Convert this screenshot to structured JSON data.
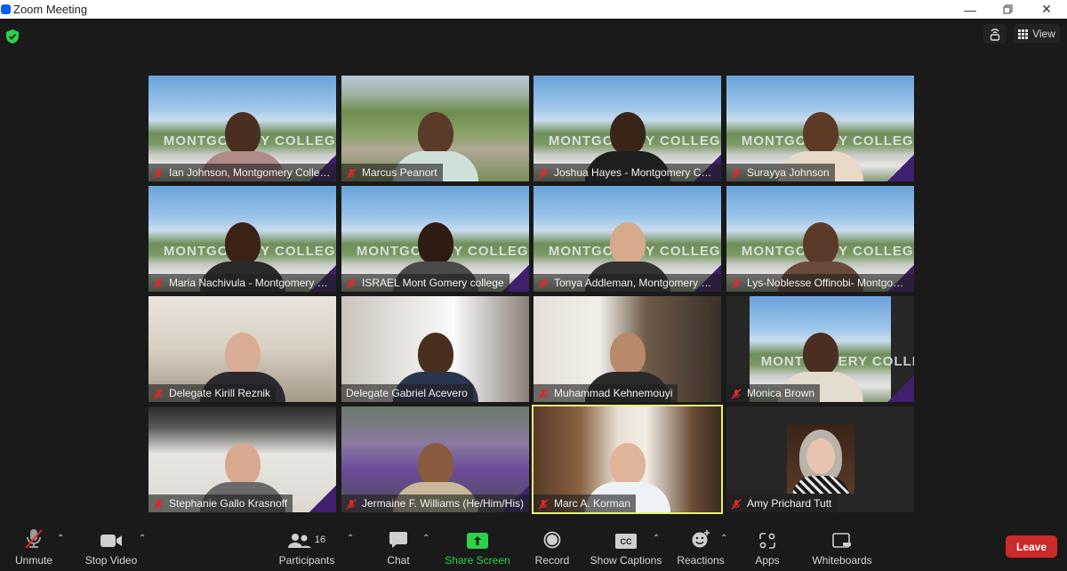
{
  "window": {
    "title": "Zoom Meeting",
    "minimize_icon": "minimize-icon",
    "restore_icon": "restore-icon",
    "close_icon": "close-icon"
  },
  "topbar": {
    "security_icon": "shield-check-icon",
    "immersive_icon": "immersive-view-icon",
    "view_label": "View"
  },
  "participants": [
    {
      "name": "Ian Johnson, Montgomery College",
      "muted": true,
      "bg": "campus",
      "sign": "MONTGOMERY COLLEGE",
      "skin": "#4a2e22",
      "shirt": "#b08a86"
    },
    {
      "name": "Marcus Peanort",
      "muted": true,
      "bg": "aerial",
      "sign": "",
      "skin": "#5a3a28",
      "shirt": "#cfe0d8"
    },
    {
      "name": "Joshua Hayes -  Montgomery Coll...",
      "muted": true,
      "bg": "campus",
      "sign": "MONTGOMERY COLLEGE",
      "skin": "#3a2418",
      "shirt": "#1e1e1e"
    },
    {
      "name": "Surayya Johnson",
      "muted": true,
      "bg": "campus",
      "sign": "MONTGOMERY COLLEGE",
      "skin": "#5c3a26",
      "shirt": "#e8d9c8"
    },
    {
      "name": "Maria Nachivula - Montgomery C...",
      "muted": true,
      "bg": "campus",
      "sign": "MONTGOMERY COLLEGE",
      "skin": "#3a2216",
      "shirt": "#2a2a2a"
    },
    {
      "name": "ISRAEL Mont Gomery college",
      "muted": true,
      "bg": "campus",
      "sign": "MONTGOMERY COLLEGE",
      "skin": "#2e1c12",
      "shirt": "#4a4a4a"
    },
    {
      "name": "Tonya Addleman, Montgomery Co...",
      "muted": true,
      "bg": "campus",
      "sign": "MONTGOMERY COLLEGE",
      "skin": "#d6a98a",
      "shirt": "#333333"
    },
    {
      "name": "Lys-Noblesse Offinobi- Montgom...",
      "muted": true,
      "bg": "campus",
      "sign": "MONTGOMERY COLLEGE",
      "skin": "#5a3a28",
      "shirt": "#6a4a3a"
    },
    {
      "name": "Delegate Kirill Reznik",
      "muted": true,
      "bg": "office1",
      "sign": "",
      "skin": "#d9ad96",
      "shirt": "#2a2a30"
    },
    {
      "name": "Delegate Gabriel Acevero",
      "muted": false,
      "bg": "office2",
      "sign": "",
      "skin": "#4a2e20",
      "shirt": "#2a3550"
    },
    {
      "name": "Muhammad Kehnemouyi",
      "muted": true,
      "bg": "office3",
      "sign": "",
      "skin": "#b88a6a",
      "shirt": "#2a2a2a"
    },
    {
      "name": "Monica Brown",
      "muted": true,
      "bg": "campus-narrow",
      "sign": "MONTGOMERY COLLEGE",
      "skin": "#4a2e22",
      "shirt": "#e4dccf"
    },
    {
      "name": "Stephanie Gallo Krasnoff",
      "muted": true,
      "bg": "gallery",
      "sign": "",
      "skin": "#d8a890",
      "shirt": "#6a6a6a"
    },
    {
      "name": "Jermaine F. Williams (He/Him/His)",
      "muted": true,
      "bg": "parade",
      "sign": "",
      "skin": "#8a5a3e",
      "shirt": "#c9b89a"
    },
    {
      "name": "Marc A. Korman",
      "muted": true,
      "bg": "study",
      "sign": "",
      "skin": "#e0b49a",
      "shirt": "#eef2f6",
      "active_speaker": true
    },
    {
      "name": "Amy Prichard Tutt",
      "muted": true,
      "bg": "avatar",
      "sign": "",
      "skin": "#e8c4b0",
      "shirt": "#1e1e1e"
    }
  ],
  "toolbar": {
    "unmute": {
      "label": "Unmute",
      "icon": "microphone-muted-icon"
    },
    "stop_video": {
      "label": "Stop Video",
      "icon": "video-camera-icon"
    },
    "participants": {
      "label": "Participants",
      "icon": "participants-icon",
      "count": "16"
    },
    "chat": {
      "label": "Chat",
      "icon": "chat-bubble-icon"
    },
    "share_screen": {
      "label": "Share Screen",
      "icon": "share-screen-icon"
    },
    "record": {
      "label": "Record",
      "icon": "record-icon"
    },
    "captions": {
      "label": "Show Captions",
      "icon": "cc-icon",
      "icon_text": "CC"
    },
    "reactions": {
      "label": "Reactions",
      "icon": "reactions-icon"
    },
    "apps": {
      "label": "Apps",
      "icon": "apps-icon"
    },
    "whiteboards": {
      "label": "Whiteboards",
      "icon": "whiteboard-icon"
    },
    "leave": {
      "label": "Leave"
    }
  },
  "colors": {
    "share_green": "#2ed14a",
    "leave_red": "#cb2b2b",
    "active_speaker": "#e4f07a",
    "mute_red": "#e02828"
  }
}
